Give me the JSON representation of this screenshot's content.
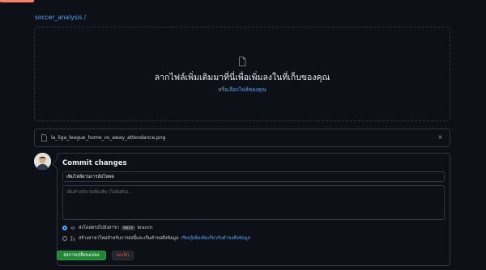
{
  "breadcrumb": {
    "repo": "soccer_analysis",
    "separator": "/"
  },
  "dropzone": {
    "title": "ลากไฟล์เพิ่มเติมมาที่นี่เพื่อเพิ่มลงในที่เก็บของคุณ",
    "prefix": "หรือ",
    "link": "เลือกไฟล์ของคุณ"
  },
  "file": {
    "name": "la_liga_league_home_vs_away_attendance.png",
    "close": "×"
  },
  "commit": {
    "title": "Commit changes",
    "summary_value": "เพิ่มไฟล์ผ่านการอัปโหลด",
    "description_placeholder": "เพิ่มคำอธิบายเพิ่มเติม (ไม่บังคับ)...",
    "option_direct": {
      "text": "ส่งโดยตรงไปยังสาขา",
      "branch": "main",
      "suffix": "branch"
    },
    "option_new_branch": {
      "text": "สร้างสาขาใหม่สำหรับการส่งนี้และเริ่มคำขอดึงข้อมูล",
      "link": "เรียนรู้เพิ่มเติมเกี่ยวกับคำขอดึงข้อมูล"
    },
    "commit_button": "ส่งการเปลี่ยนแปลง",
    "cancel_button": "ยกเลิก"
  },
  "colors": {
    "accent": "#58a6ff",
    "primary_button": "#238636",
    "danger": "#f85149",
    "background": "#0d1117"
  }
}
